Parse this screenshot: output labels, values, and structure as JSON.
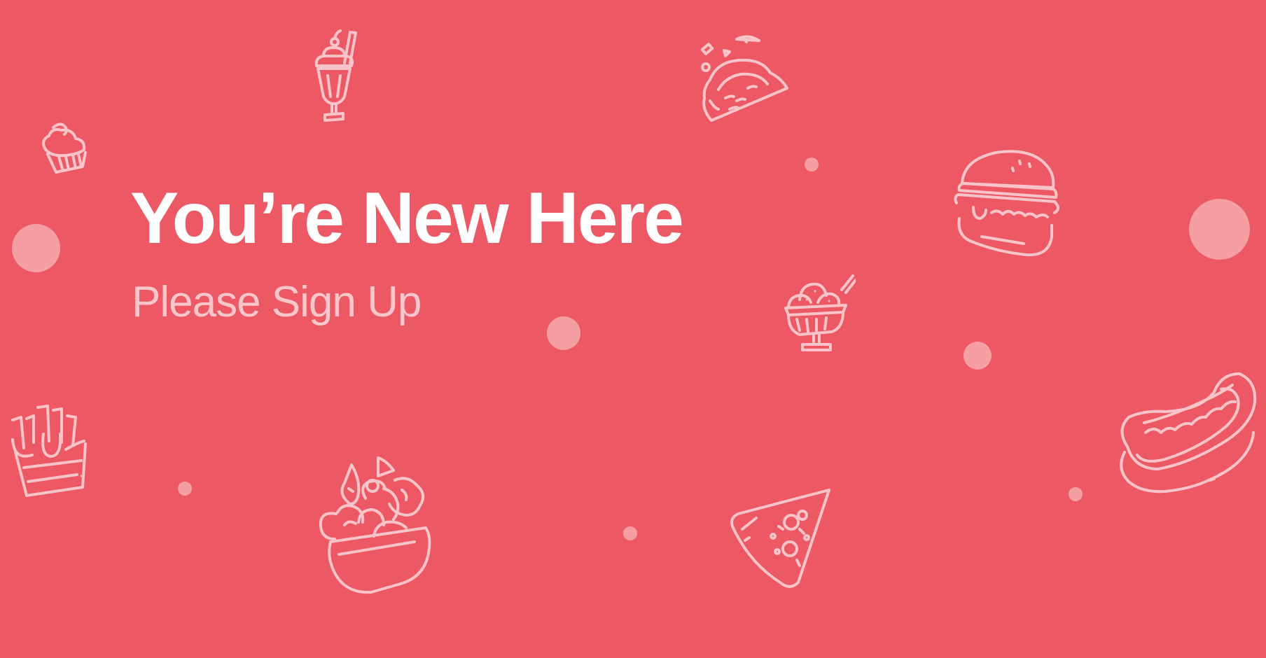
{
  "hero": {
    "headline": "You’re New Here",
    "subheadline": "Please Sign Up"
  },
  "decorations": {
    "icons": [
      "milkshake-icon",
      "taco-icon",
      "cupcake-icon",
      "burger-icon",
      "ice-cream-sundae-icon",
      "fries-icon",
      "salad-bowl-icon",
      "pizza-slice-icon",
      "hot-dog-icon"
    ]
  },
  "colors": {
    "background": "#ec5964",
    "headline": "#ffffff",
    "subheadline": "#f8c6cb",
    "dot": "#f59ea4",
    "icon_stroke": "#f9c4c9"
  }
}
